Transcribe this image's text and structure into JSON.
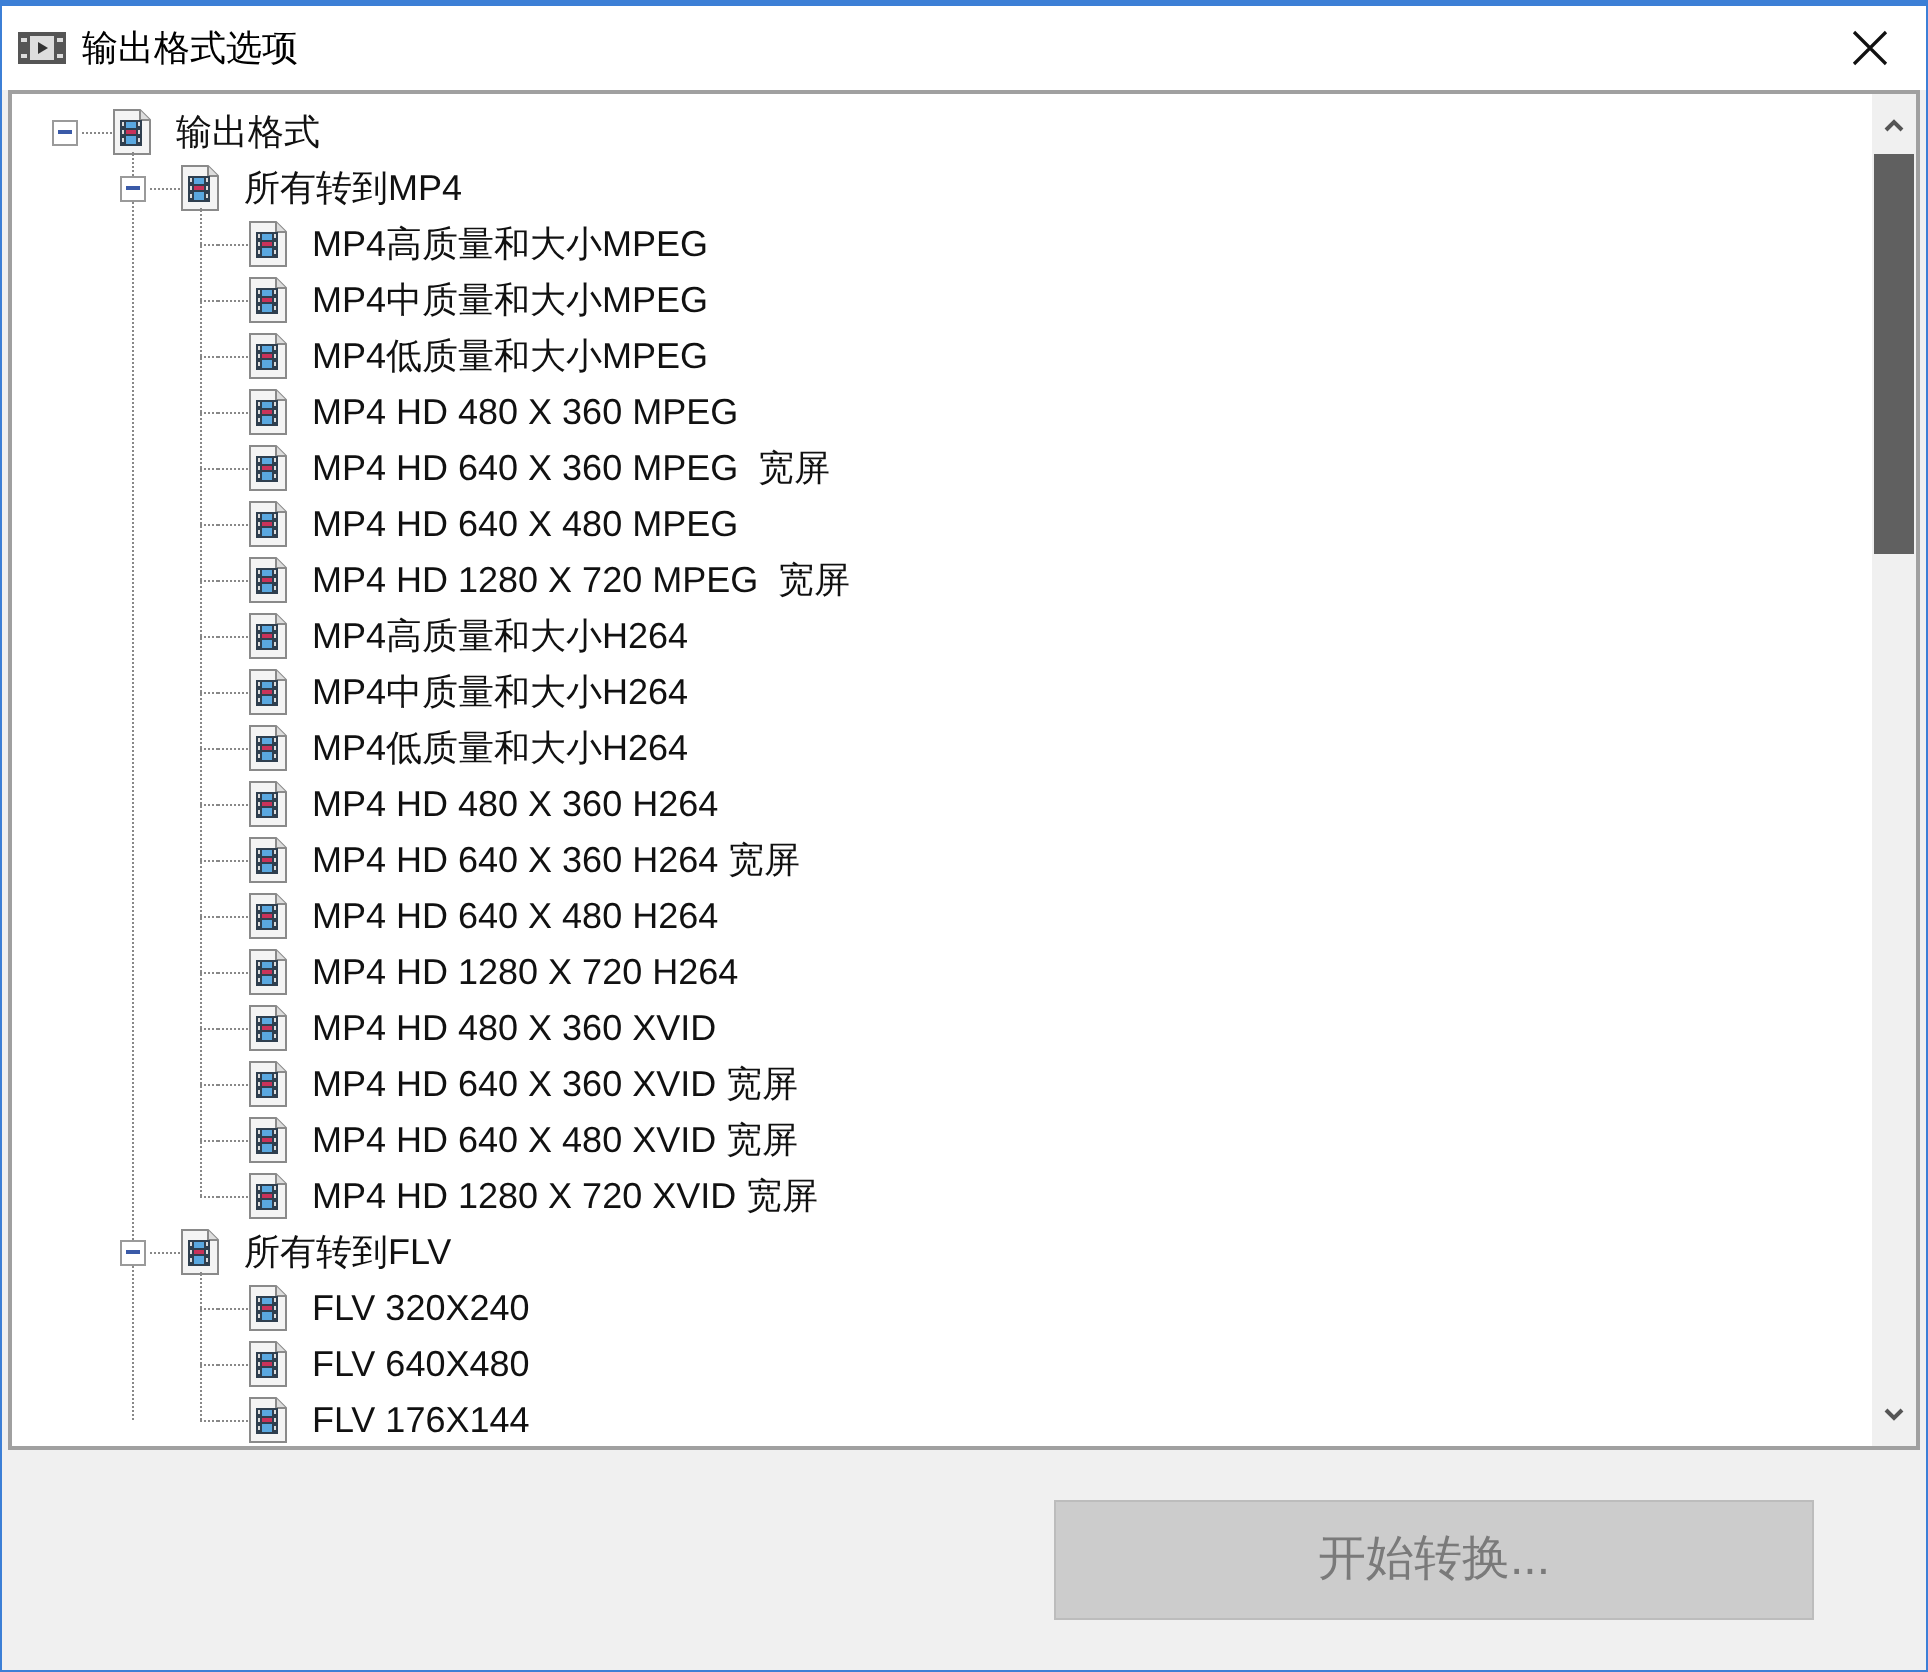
{
  "window": {
    "title": "输出格式选项"
  },
  "tree": [
    {
      "label": "输出格式",
      "expanded": true,
      "children": [
        {
          "label": "所有转到MP4",
          "expanded": true,
          "children": [
            {
              "label": "MP4高质量和大小MPEG"
            },
            {
              "label": "MP4中质量和大小MPEG"
            },
            {
              "label": "MP4低质量和大小MPEG"
            },
            {
              "label": "MP4 HD 480 X 360 MPEG"
            },
            {
              "label": "MP4 HD 640 X 360 MPEG  宽屏"
            },
            {
              "label": "MP4 HD 640 X 480 MPEG"
            },
            {
              "label": "MP4 HD 1280 X 720 MPEG  宽屏"
            },
            {
              "label": "MP4高质量和大小H264"
            },
            {
              "label": "MP4中质量和大小H264"
            },
            {
              "label": "MP4低质量和大小H264"
            },
            {
              "label": "MP4 HD 480 X 360 H264"
            },
            {
              "label": "MP4 HD 640 X 360 H264 宽屏"
            },
            {
              "label": "MP4 HD 640 X 480 H264"
            },
            {
              "label": "MP4 HD 1280 X 720 H264"
            },
            {
              "label": "MP4 HD 480 X 360 XVID"
            },
            {
              "label": "MP4 HD 640 X 360 XVID 宽屏"
            },
            {
              "label": "MP4 HD 640 X 480 XVID 宽屏"
            },
            {
              "label": "MP4 HD 1280 X 720 XVID 宽屏"
            }
          ]
        },
        {
          "label": "所有转到FLV",
          "expanded": true,
          "children": [
            {
              "label": "FLV 320X240"
            },
            {
              "label": "FLV 640X480"
            },
            {
              "label": "FLV 176X144"
            }
          ]
        }
      ]
    }
  ],
  "button": {
    "label": "开始转换...",
    "disabled": true
  }
}
